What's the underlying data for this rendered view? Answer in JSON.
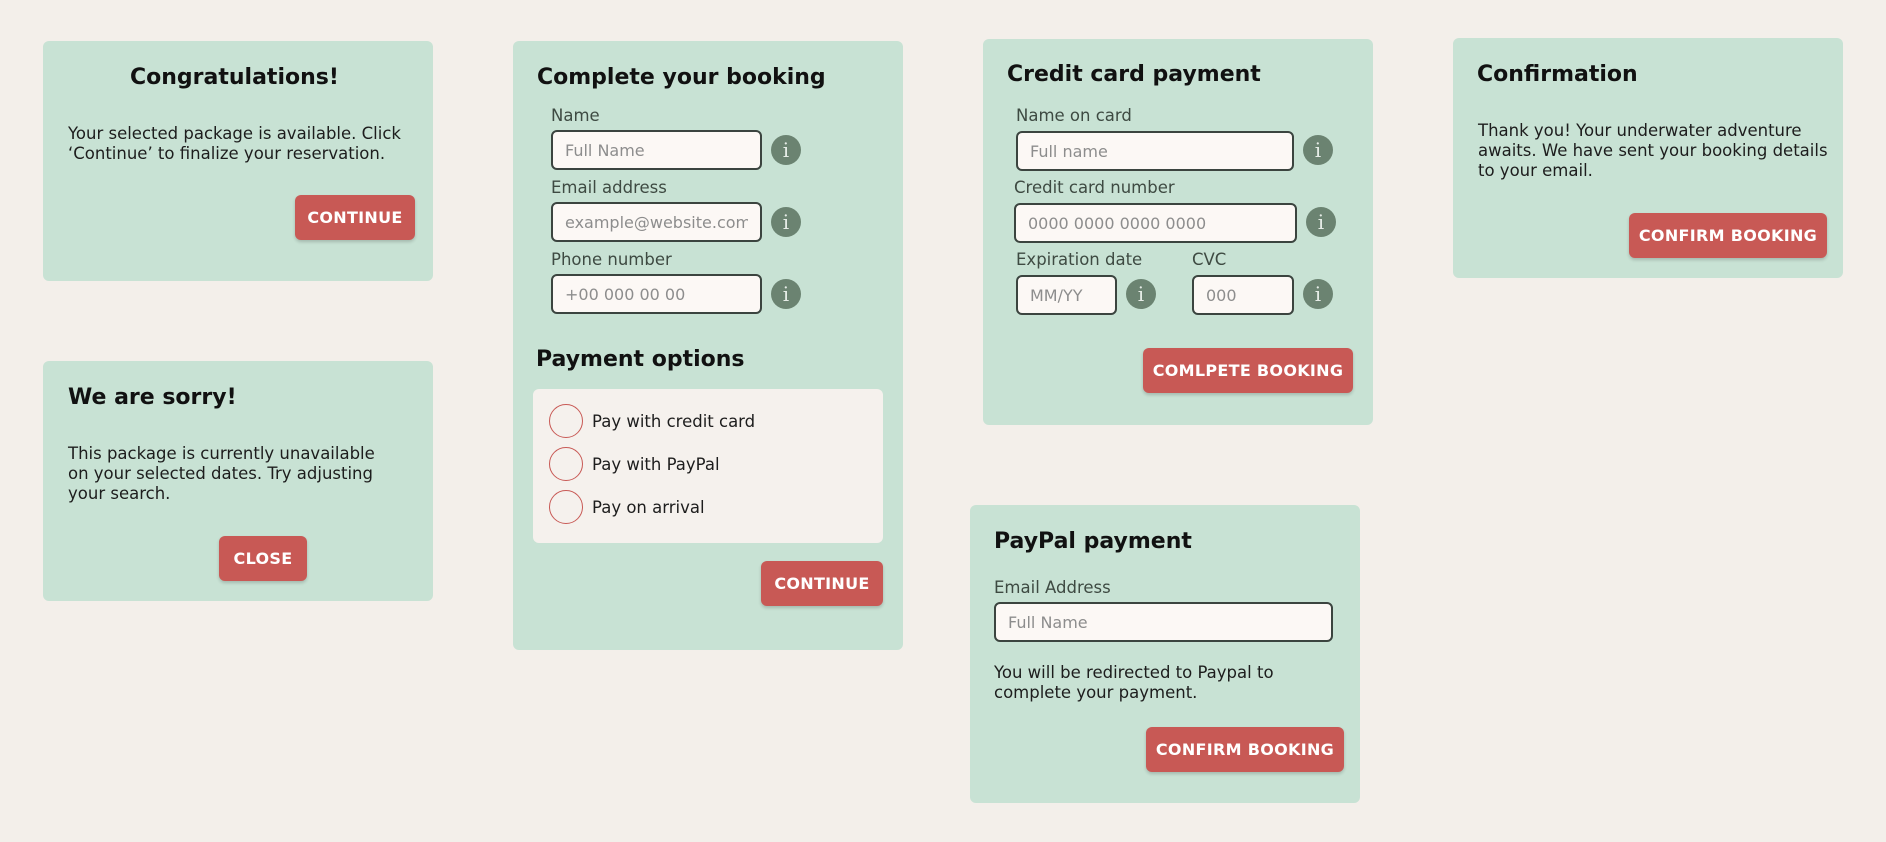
{
  "congrats": {
    "title": "Congratulations!",
    "message": "Your selected package is available. Click ‘Continue’ to finalize your reservation.",
    "button": "CONTINUE"
  },
  "sorry": {
    "title": "We are sorry!",
    "message": "This package is currently unavailable on your selected dates. Try adjusting your search.",
    "button": "CLOSE"
  },
  "booking": {
    "title": "Complete your booking",
    "name_label": "Name",
    "name_placeholder": "Full Name",
    "email_label": "Email address",
    "email_placeholder": "example@website.com",
    "phone_label": "Phone number",
    "phone_placeholder": "+00 000 00 00",
    "info_glyph": "i",
    "payment_title": "Payment options",
    "payment_options": [
      "Pay with credit card",
      "Pay with PayPal",
      "Pay on arrival"
    ],
    "button": "CONTINUE"
  },
  "credit_card": {
    "title": "Credit card payment",
    "name_label": "Name on card",
    "name_placeholder": "Full name",
    "number_label": "Credit card number",
    "number_placeholder": "0000 0000 0000 0000",
    "expiry_label": "Expiration date",
    "expiry_placeholder": "MM/YY",
    "cvc_label": "CVC",
    "cvc_placeholder": "000",
    "info_glyph": "i",
    "button": "COMLPETE BOOKING"
  },
  "paypal": {
    "title": "PayPal payment",
    "email_label": "Email Address",
    "email_placeholder": "Full Name",
    "message": "You will be redirected to Paypal to complete your payment.",
    "button": "CONFIRM BOOKING"
  },
  "confirmation": {
    "title": "Confirmation",
    "message": "Thank you! Your underwater adventure awaits. We have sent your booking details to your email.",
    "button": "CONFIRM BOOKING"
  },
  "colors": {
    "page_background": "#f3efea",
    "card_background": "#c8e2d4",
    "button_accent": "#c85955",
    "info_icon": "#6b8371",
    "input_border": "#3b443f"
  }
}
